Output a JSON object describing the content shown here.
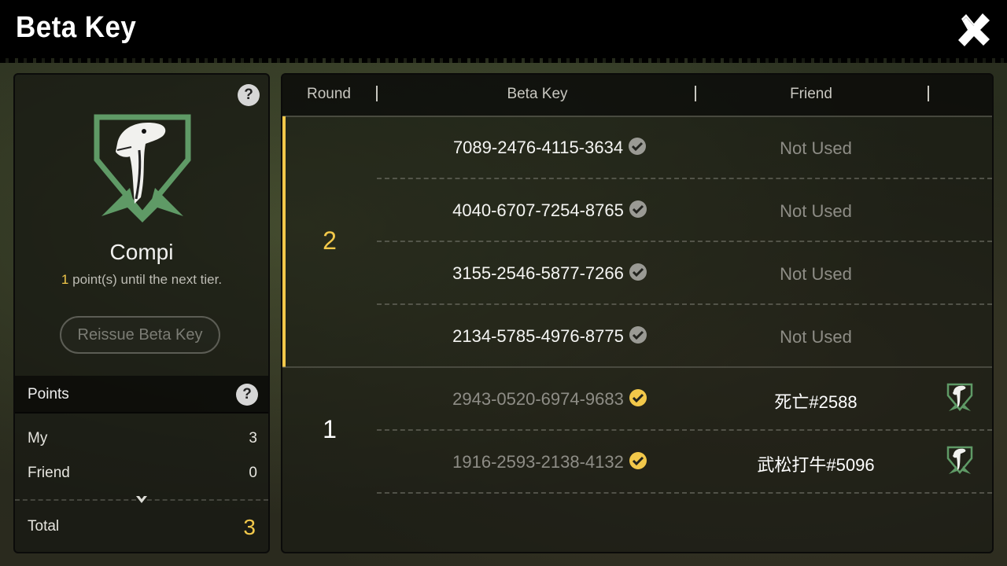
{
  "window": {
    "title": "Beta Key",
    "close_icon": "close-x-icon"
  },
  "tier": {
    "name": "Compi",
    "points_needed": "1",
    "next_tier_text": "point(s) until the next tier.",
    "emblem_icon": "dino-head-shield-icon",
    "emblem_color": "#5f9a66"
  },
  "reissue_label": "Reissue Beta Key",
  "points": {
    "header": "Points",
    "my_label": "My",
    "my_value": "3",
    "friend_label": "Friend",
    "friend_value": "0",
    "total_label": "Total",
    "total_value": "3"
  },
  "table": {
    "headers": {
      "round": "Round",
      "key": "Beta Key",
      "friend": "Friend"
    },
    "rounds": [
      {
        "round": "2",
        "rows": [
          {
            "key": "7089-2476-4115-3634",
            "status": "unused",
            "friend": "Not Used"
          },
          {
            "key": "4040-6707-7254-8765",
            "status": "unused",
            "friend": "Not Used"
          },
          {
            "key": "3155-2546-5877-7266",
            "status": "unused",
            "friend": "Not Used"
          },
          {
            "key": "2134-5785-4976-8775",
            "status": "unused",
            "friend": "Not Used"
          }
        ]
      },
      {
        "round": "1",
        "rows": [
          {
            "key": "2943-0520-6974-9683",
            "status": "used",
            "friend": "死亡#2588"
          },
          {
            "key": "1916-2593-2138-4132",
            "status": "used",
            "friend": "武松打牛#5096"
          }
        ]
      }
    ]
  },
  "colors": {
    "accent_gold": "#f2c84a",
    "check_gray": "#9a9a94",
    "check_gold": "#f2c84a"
  }
}
